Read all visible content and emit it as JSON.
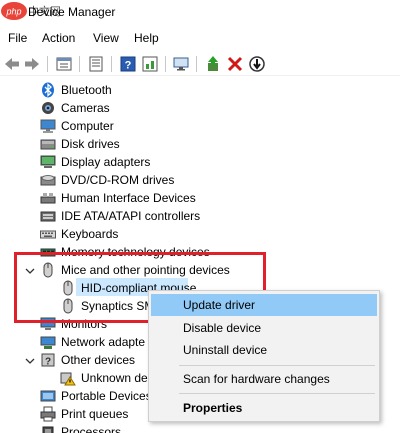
{
  "window": {
    "title": "Device Manager",
    "watermark": "php 中文网"
  },
  "menu": [
    "File",
    "Action",
    "View",
    "Help"
  ],
  "toolbar_icons": [
    "back-arrow-icon",
    "forward-arrow-icon",
    "properties-icon",
    "show-hidden-icon",
    "help-icon",
    "action-icon",
    "scan-hardware-icon",
    "update-driver-icon",
    "uninstall-icon",
    "disable-icon"
  ],
  "tree": [
    {
      "label": "Bluetooth",
      "icon": "bluetooth-icon"
    },
    {
      "label": "Cameras",
      "icon": "camera-icon"
    },
    {
      "label": "Computer",
      "icon": "computer-icon"
    },
    {
      "label": "Disk drives",
      "icon": "disk-icon"
    },
    {
      "label": "Display adapters",
      "icon": "display-icon"
    },
    {
      "label": "DVD/CD-ROM drives",
      "icon": "dvd-icon"
    },
    {
      "label": "Human Interface Devices",
      "icon": "hid-icon"
    },
    {
      "label": "IDE ATA/ATAPI controllers",
      "icon": "ide-icon"
    },
    {
      "label": "Keyboards",
      "icon": "keyboard-icon"
    },
    {
      "label": "Memory technology devices",
      "icon": "memory-icon"
    },
    {
      "label": "Mice and other pointing devices",
      "icon": "mouse-icon"
    },
    {
      "label": "HID-compliant mouse",
      "icon": "mouse-icon"
    },
    {
      "label": "Synaptics SM",
      "icon": "mouse-icon"
    },
    {
      "label": "Monitors",
      "icon": "monitor-icon"
    },
    {
      "label": "Network adapte",
      "icon": "network-icon"
    },
    {
      "label": "Other devices",
      "icon": "other-devices-icon"
    },
    {
      "label": "Unknown de",
      "icon": "warning-icon"
    },
    {
      "label": "Portable Devices",
      "icon": "portable-icon"
    },
    {
      "label": "Print queues",
      "icon": "printer-icon"
    },
    {
      "label": "Processors",
      "icon": "processor-icon"
    }
  ],
  "context_menu": {
    "update": "Update driver",
    "disable": "Disable device",
    "uninstall": "Uninstall device",
    "scan": "Scan for hardware changes",
    "properties": "Properties"
  },
  "colors": {
    "highlight_border": "#e0202a",
    "selection": "#cce8ff",
    "menu_hover": "#91c9f7"
  }
}
